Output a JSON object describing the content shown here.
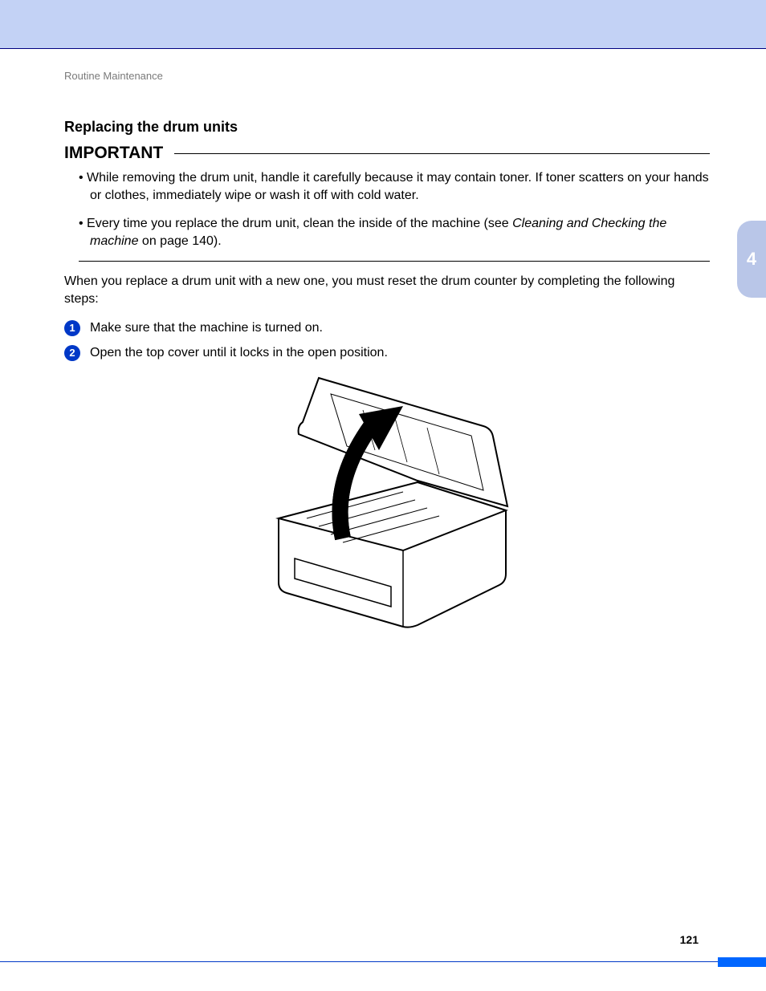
{
  "breadcrumb": "Routine Maintenance",
  "heading": "Replacing the drum units",
  "important_label": "IMPORTANT",
  "bullets": {
    "b1": "While removing the drum unit, handle it carefully because it may contain toner. If toner scatters on your hands or clothes, immediately wipe or wash it off with cold water.",
    "b2_pre": "Every time you replace the drum unit, clean the inside of the machine (see ",
    "b2_xref": "Cleaning and Checking the machine",
    "b2_post": " on page 140)."
  },
  "intro": "When you replace a drum unit with a new one, you must reset the drum counter by completing the following steps:",
  "steps": {
    "s1_num": "1",
    "s1_text": "Make sure that the machine is turned on.",
    "s2_num": "2",
    "s2_text": "Open the top cover until it locks in the open position."
  },
  "chapter_tab": "4",
  "page_number": "121"
}
